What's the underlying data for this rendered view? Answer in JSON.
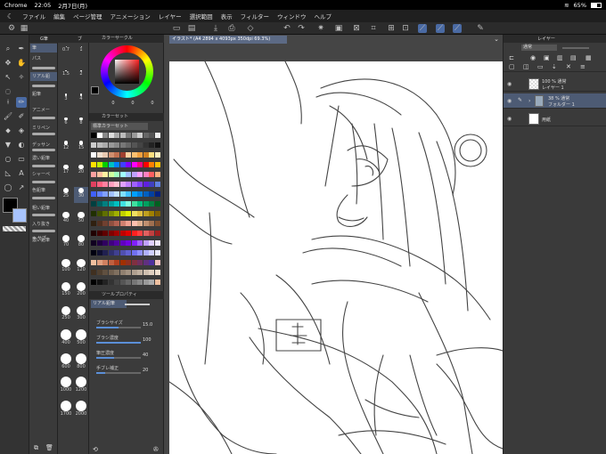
{
  "status_bar": {
    "browser": "Chrome",
    "time": "22:05",
    "date": "2月7日(月)",
    "battery": "65%"
  },
  "menu": [
    "ファイル",
    "編集",
    "ページ管理",
    "アニメーション",
    "レイヤー",
    "選択範囲",
    "表示",
    "フィルター",
    "ウィンドウ",
    "ヘルプ"
  ],
  "subtool": {
    "tab1": "G筆",
    "tab2": "ブ",
    "items": [
      "筆",
      "パス",
      "リアル鉛",
      "鉛筆",
      "アニメー",
      "ミリペン",
      "デッサン",
      "濃い鉛筆",
      "シャーペ",
      "色鉛筆",
      "粗い鉛筆",
      "入り抜き",
      "濃い鉛筆"
    ],
    "footer": "サブ"
  },
  "brush_sizes": {
    "left": [
      "0.7",
      "1.5",
      "3",
      "6",
      "12",
      "17",
      "25",
      "40",
      "70",
      "100",
      "150",
      "250",
      "400",
      "600",
      "1000",
      "1700"
    ],
    "right": [
      "1",
      "2",
      "4",
      "8",
      "15",
      "20",
      "30",
      "50",
      "80",
      "120",
      "200",
      "300",
      "500",
      "800",
      "1200",
      "2000"
    ]
  },
  "color_wheel": {
    "title": "カラーサークル",
    "values": [
      "0",
      "0",
      "0"
    ]
  },
  "color_set": {
    "title": "カラーセット",
    "set_name": "標準カラーセット"
  },
  "tool_property": {
    "title": "ツールプロパティ",
    "tool_name": "リアル鉛筆",
    "props": [
      {
        "label": "ブラシサイズ",
        "value": "15.0",
        "fill": 0.5
      },
      {
        "label": "ブラシ濃度",
        "value": "100",
        "fill": 1.0
      },
      {
        "label": "筆圧濃度",
        "value": "40",
        "fill": 0.4
      },
      {
        "label": "手ブレ補正",
        "value": "20",
        "fill": 0.2
      }
    ]
  },
  "document_tab": "イラスト* (A4 2894 x 4093px 350dpi 69.3%)",
  "layer_panel": {
    "title": "レイヤー",
    "blend": "通常",
    "layers": [
      {
        "opacity": "100 % 通常",
        "name": "レイヤー 1"
      },
      {
        "opacity": "38 % 通常",
        "name": "フォルダー 1"
      },
      {
        "opacity": "",
        "name": "用紙"
      }
    ]
  },
  "colors": {
    "accent": "#5b8fd8",
    "main_color": "#000000",
    "sub_color": "#a8c4ff"
  }
}
